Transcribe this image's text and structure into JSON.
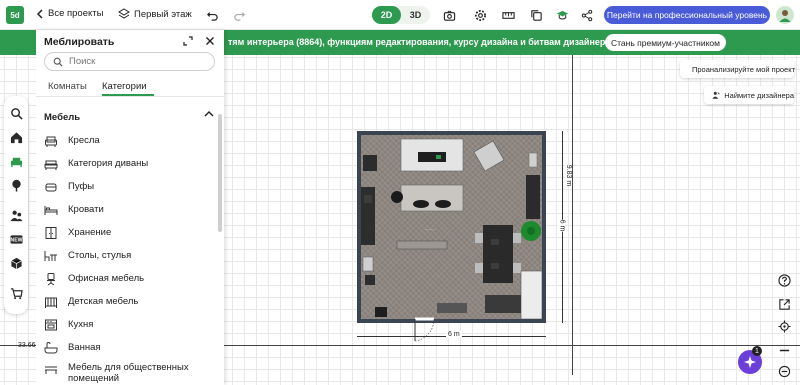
{
  "header": {
    "back_label": "Все проекты",
    "floor_label": "Первый этаж",
    "view_2d": "2D",
    "view_3d": "3D",
    "pro_button": "Перейти на профессиональный уровень"
  },
  "banner": {
    "text": "тям интерьера (8864), функциям редактирования, курсу дизайна и битвам дизайнеров",
    "button": "Стань премиум-участником"
  },
  "panel": {
    "title": "Меблировать",
    "search_placeholder": "Поиск",
    "tabs": [
      "Комнаты",
      "Категории"
    ],
    "section": "Мебель",
    "categories": [
      "Кресла",
      "Категория диваны",
      "Пуфы",
      "Кровати",
      "Хранение",
      "Столы, стулья",
      "Офисная мебель",
      "Детская мебель",
      "Кухня",
      "Ванная",
      "Мебель для общественных помещений"
    ]
  },
  "plan": {
    "width_label": "6 m",
    "height_label": "6 m",
    "outer_height_label": "9.83 m",
    "scale_label": "33.66"
  },
  "right": {
    "analyze": "Проанализируйте мой проект",
    "find_designer": "Наймите дизайнера",
    "ai_badge": "1"
  },
  "colors": {
    "brand_green": "#2e9a4f",
    "pro_blue": "#4a5bd8",
    "ai_purple": "#6b3fd9"
  }
}
